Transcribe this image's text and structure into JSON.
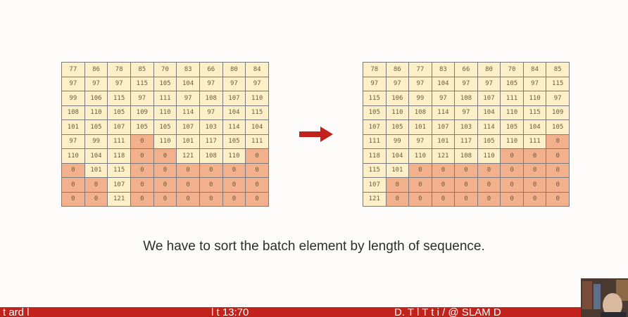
{
  "slide": {
    "left_grid": [
      [
        "77",
        "86",
        "78",
        "85",
        "70",
        "83",
        "66",
        "80",
        "84"
      ],
      [
        "97",
        "97",
        "97",
        "115",
        "105",
        "104",
        "97",
        "97",
        "97"
      ],
      [
        "99",
        "106",
        "115",
        "97",
        "111",
        "97",
        "108",
        "107",
        "110"
      ],
      [
        "108",
        "110",
        "105",
        "109",
        "110",
        "114",
        "97",
        "104",
        "115"
      ],
      [
        "101",
        "105",
        "107",
        "105",
        "105",
        "107",
        "103",
        "114",
        "104"
      ],
      [
        "97",
        "99",
        "111",
        "0",
        "110",
        "101",
        "117",
        "105",
        "111"
      ],
      [
        "110",
        "104",
        "118",
        "0",
        "0",
        "121",
        "108",
        "110",
        "0"
      ],
      [
        "0",
        "101",
        "115",
        "0",
        "0",
        "0",
        "0",
        "0",
        "0"
      ],
      [
        "0",
        "0",
        "107",
        "0",
        "0",
        "0",
        "0",
        "0",
        "0"
      ],
      [
        "0",
        "0",
        "121",
        "0",
        "0",
        "0",
        "0",
        "0",
        "0"
      ]
    ],
    "right_grid": [
      [
        "78",
        "86",
        "77",
        "83",
        "66",
        "80",
        "70",
        "84",
        "85"
      ],
      [
        "97",
        "97",
        "97",
        "104",
        "97",
        "97",
        "105",
        "97",
        "115"
      ],
      [
        "115",
        "106",
        "99",
        "97",
        "108",
        "107",
        "111",
        "110",
        "97"
      ],
      [
        "105",
        "110",
        "108",
        "114",
        "97",
        "104",
        "110",
        "115",
        "109"
      ],
      [
        "107",
        "105",
        "101",
        "107",
        "103",
        "114",
        "105",
        "104",
        "105"
      ],
      [
        "111",
        "99",
        "97",
        "101",
        "117",
        "105",
        "110",
        "111",
        "0"
      ],
      [
        "118",
        "104",
        "110",
        "121",
        "108",
        "110",
        "0",
        "0",
        "0"
      ],
      [
        "115",
        "101",
        "0",
        "0",
        "0",
        "0",
        "0",
        "0",
        "0"
      ],
      [
        "107",
        "0",
        "0",
        "0",
        "0",
        "0",
        "0",
        "0",
        "0"
      ],
      [
        "121",
        "0",
        "0",
        "0",
        "0",
        "0",
        "0",
        "0",
        "0"
      ]
    ],
    "caption": "We have to sort the batch element by length of sequence."
  },
  "footer": {
    "left_text": "t    ard  l                  ",
    "mid_text": "l  t      13:70",
    "right_text": "D. T     l    T  t   i / @ SLAM D"
  },
  "colors": {
    "value_cell": "#fdf0c9",
    "pad_cell": "#f2b08d",
    "arrow": "#c1221b",
    "footer_bar": "#c1221b"
  },
  "icons": {
    "arrow": "right-arrow-icon"
  }
}
